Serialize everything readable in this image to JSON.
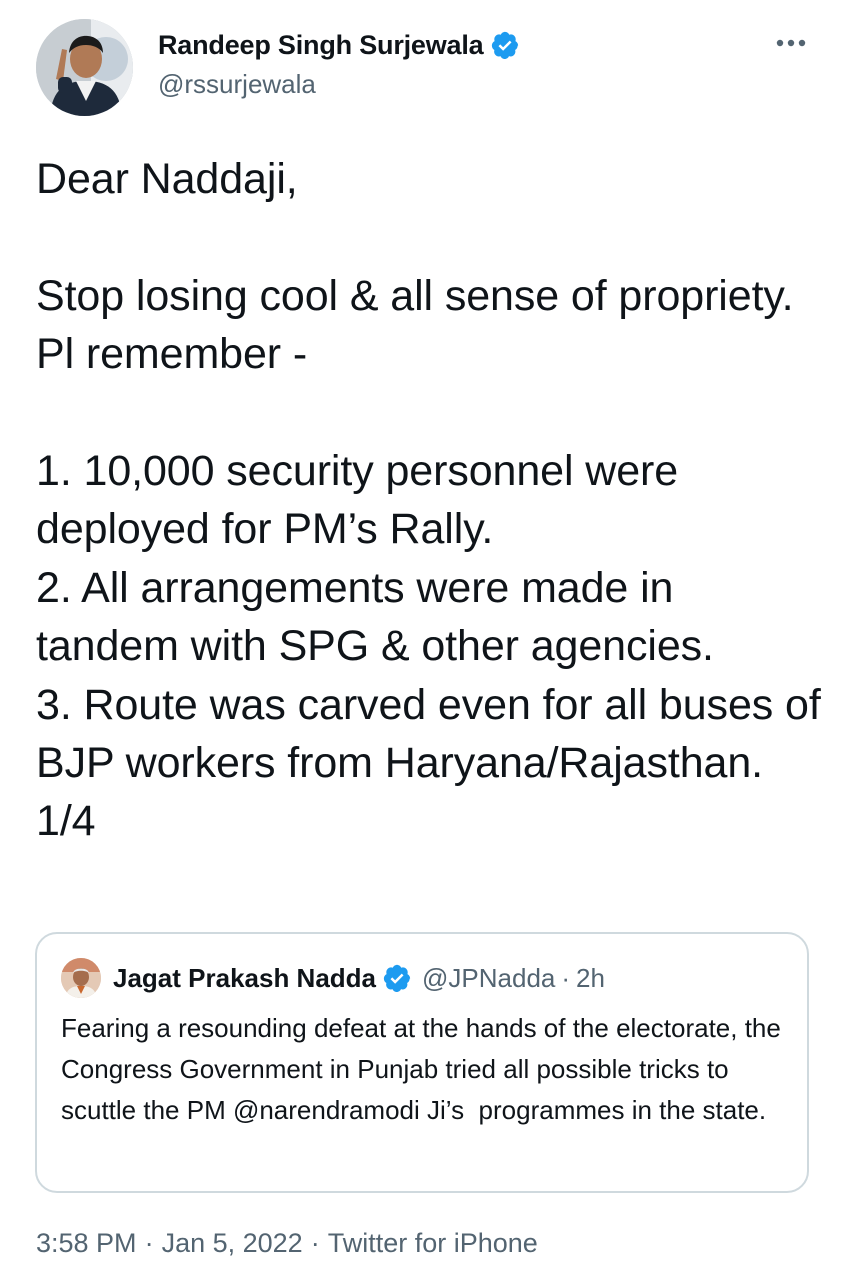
{
  "tweet": {
    "author": {
      "name": "Randeep Singh Surjewala",
      "handle": "@rssurjewala",
      "avatar_icon": "person-avatar",
      "verified_icon": "verified-badge-icon"
    },
    "more_icon": "more-options-icon",
    "text": "Dear Naddaji,\n\nStop losing cool & all sense of propriety. Pl remember -\n\n1. 10,000 security personnel were deployed for PM’s Rally.\n2. All arrangements were made in tandem with SPG & other agencies.\n3. Route was carved even for all buses of BJP workers from Haryana/Rajasthan.\n1/4",
    "quoted": {
      "name": "Jagat Prakash Nadda",
      "handle": "@JPNadda",
      "separator": "·",
      "time": "2h",
      "text": "Fearing a resounding defeat at the hands of the electorate, the Congress Government in Punjab tried all possible tricks to scuttle the PM @narendramodi Ji’s  programmes in the state."
    },
    "meta": {
      "time": "3:58 PM",
      "date": "Jan 5, 2022",
      "source": "Twitter for iPhone",
      "separator": "·"
    }
  },
  "colors": {
    "verified_blue": "#1d9bf0",
    "text_primary": "#0f1419",
    "text_secondary": "#536471",
    "border": "#cfd9de"
  }
}
